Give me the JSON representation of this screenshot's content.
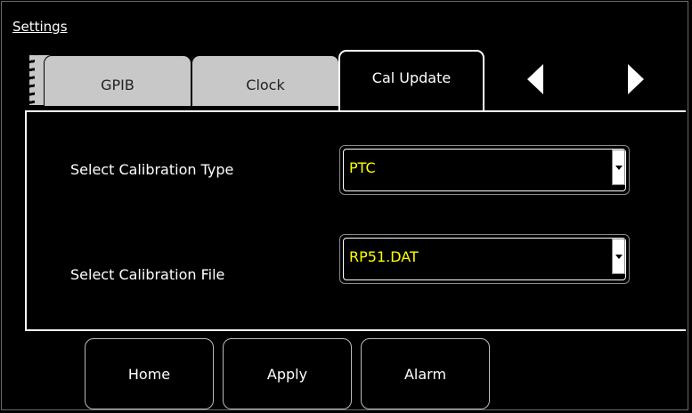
{
  "window": {
    "title": "Settings"
  },
  "tabs": [
    {
      "label": "GPIB",
      "active": false
    },
    {
      "label": "Clock",
      "active": false
    },
    {
      "label": "Cal Update",
      "active": true
    }
  ],
  "nav": {
    "prev_icon": "triangle-left-icon",
    "next_icon": "triangle-right-icon"
  },
  "form": {
    "calibration_type": {
      "label": "Select Calibration Type",
      "value": "PTC"
    },
    "calibration_file": {
      "label": "Select Calibration File",
      "value": "RP51.DAT"
    }
  },
  "buttons": {
    "home": "Home",
    "apply": "Apply",
    "alarm": "Alarm"
  },
  "colors": {
    "background": "#000000",
    "tab_inactive": "#c8c8c8",
    "value_text": "#ffff00",
    "border": "#ffffff"
  }
}
